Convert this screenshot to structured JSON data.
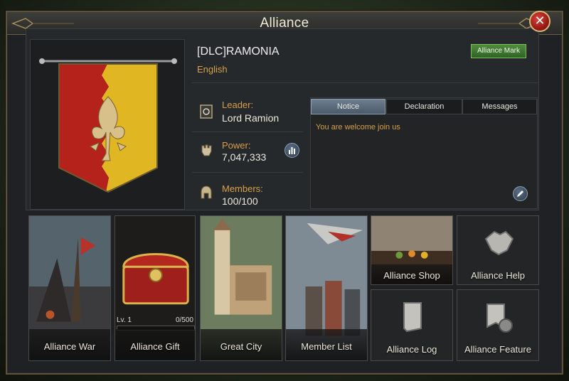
{
  "window": {
    "title": "Alliance"
  },
  "alliance": {
    "name": "[DLC]RAMONIA",
    "language": "English",
    "mark_button": "Alliance Mark"
  },
  "stats": {
    "leader_label": "Leader:",
    "leader_value": "Lord Ramion",
    "power_label": "Power:",
    "power_value": "7,047,333",
    "members_label": "Members:",
    "members_value": "100/100"
  },
  "tabs": [
    {
      "label": "Notice",
      "active": true
    },
    {
      "label": "Declaration",
      "active": false
    },
    {
      "label": "Messages",
      "active": false
    }
  ],
  "notice": {
    "text": "You are welcome join us"
  },
  "tiles": {
    "war": "Alliance War",
    "gift": "Alliance Gift",
    "gift_level": "Lv. 1",
    "gift_progress": "0/500",
    "gift_progress_fraction": 0,
    "city": "Great City",
    "members": "Member List",
    "shop": "Alliance Shop",
    "help": "Alliance Help",
    "log": "Alliance Log",
    "feature": "Alliance Feature"
  },
  "icons": {
    "close": "close-icon",
    "leader": "leader-icon",
    "power": "power-fist-icon",
    "members": "helmet-icon",
    "stats": "bar-chart-icon",
    "edit": "edit-icon"
  },
  "colors": {
    "accent_gold": "#d6a04a",
    "mark_button_green": "#3f7a32",
    "tab_active": "#5c6d80",
    "close_red": "#b52a22"
  }
}
